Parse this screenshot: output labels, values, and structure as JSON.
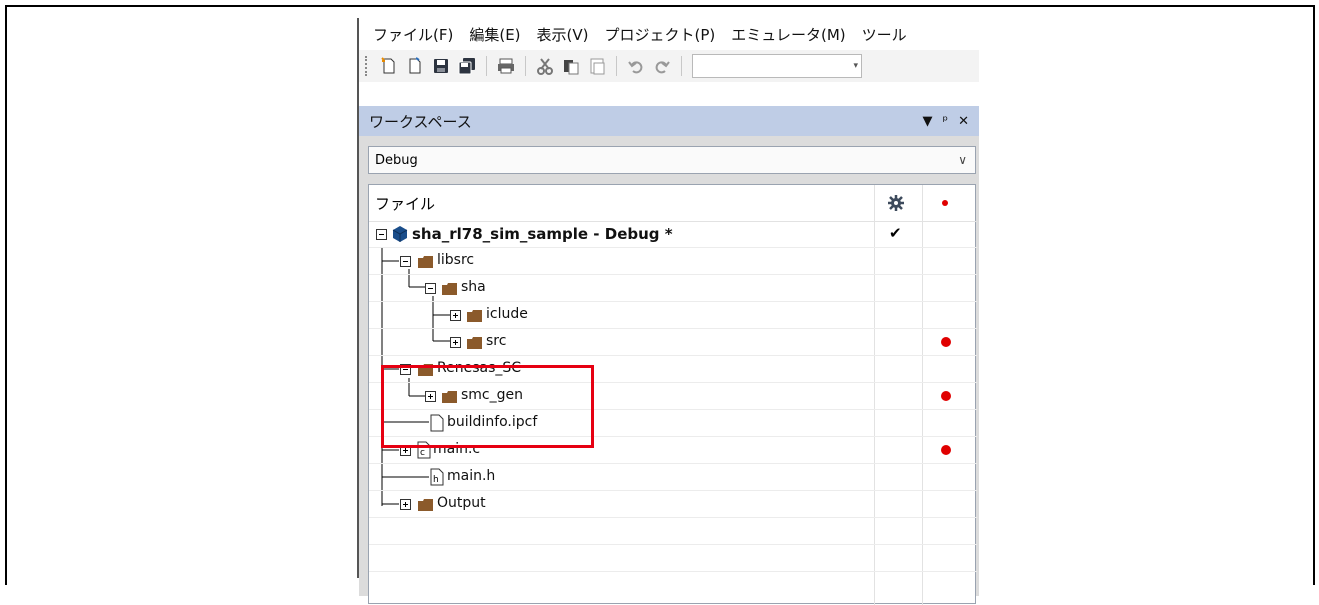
{
  "menu": [
    "ファイル(F)",
    "編集(E)",
    "表示(V)",
    "プロジェクト(P)",
    "エミュレータ(M)",
    "ツール"
  ],
  "toolbar": {
    "buttons": [
      "new-file-icon",
      "new-project-icon",
      "save-icon",
      "save-all-icon",
      "print-icon",
      "cut-icon",
      "copy-icon",
      "paste-icon",
      "undo-icon",
      "redo-icon"
    ],
    "combo_value": ""
  },
  "workspace": {
    "title": "ワークスペース",
    "controls": [
      "▼",
      "ᵖ",
      "✕"
    ],
    "configuration": "Debug",
    "column_header": "ファイル",
    "column_icons": [
      "gear-icon",
      "red-dot-icon"
    ]
  },
  "tree": [
    {
      "label": "sha_rl78_sim_sample - Debug *",
      "check": "✔",
      "dot": false
    },
    {
      "label": "libsrc",
      "dot": false
    },
    {
      "label": "sha",
      "dot": false
    },
    {
      "label": "iclude",
      "dot": false
    },
    {
      "label": "src",
      "dot": true
    },
    {
      "label": "Renesas_SC",
      "dot": false
    },
    {
      "label": "smc_gen",
      "dot": true
    },
    {
      "label": "buildinfo.ipcf",
      "dot": false
    },
    {
      "label": "main.c",
      "dot": true
    },
    {
      "label": "main.h",
      "dot": false
    },
    {
      "label": "Output",
      "dot": false
    }
  ],
  "colors": {
    "highlight": "#e60012",
    "title_bar": "#bfcde6",
    "folder": "#8b5a2b",
    "dot": "#e00000"
  }
}
